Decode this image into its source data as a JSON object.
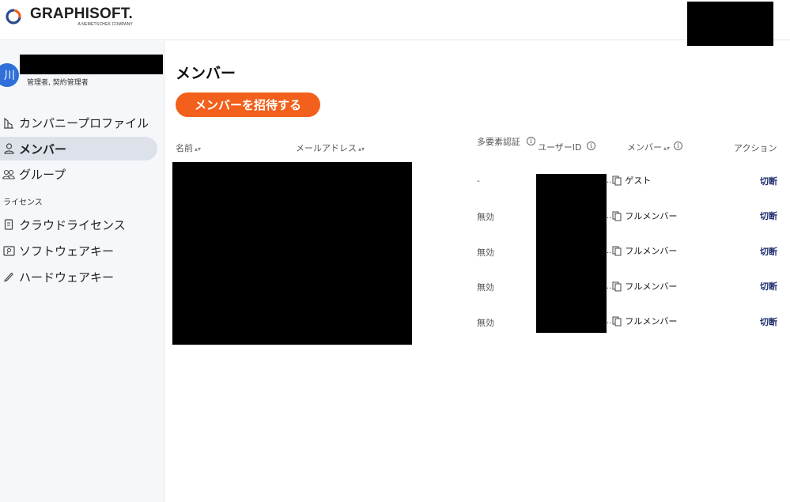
{
  "header": {
    "logo_text": "GRAPHISOFT.",
    "logo_subtext": "A NEMETSCHEK COMPANY"
  },
  "sidebar": {
    "avatar_initial": "川",
    "profile_role": "管理者, 契約管理者",
    "items": [
      {
        "label": "カンパニープロファイル",
        "icon": "building-icon"
      },
      {
        "label": "メンバー",
        "icon": "person-icon",
        "active": true
      },
      {
        "label": "グループ",
        "icon": "group-icon"
      }
    ],
    "section_label": "ライセンス",
    "license_items": [
      {
        "label": "クラウドライセンス",
        "icon": "cloud-license-icon"
      },
      {
        "label": "ソフトウェアキー",
        "icon": "software-key-icon"
      },
      {
        "label": "ハードウェアキー",
        "icon": "hardware-key-icon"
      }
    ]
  },
  "main": {
    "title": "メンバー",
    "invite_button": "メンバーを招待する",
    "columns": {
      "name": "名前",
      "email": "メールアドレス",
      "mfa": "多要素認証",
      "user_id": "ユーザーID",
      "member": "メンバー",
      "action": "アクション"
    },
    "rows": [
      {
        "mfa": "-",
        "member": "ゲスト",
        "action": "切断"
      },
      {
        "mfa": "無効",
        "member": "フルメンバー",
        "action": "切断"
      },
      {
        "mfa": "無効",
        "member": "フルメンバー",
        "action": "切断"
      },
      {
        "mfa": "無効",
        "member": "フルメンバー",
        "action": "切断"
      },
      {
        "mfa": "無効",
        "member": "フルメンバー",
        "action": "切断"
      }
    ]
  },
  "colors": {
    "accent": "#f2601b",
    "avatar": "#2f6fd9",
    "action_text": "#1d2b6b",
    "active_nav": "#dde1ea"
  }
}
